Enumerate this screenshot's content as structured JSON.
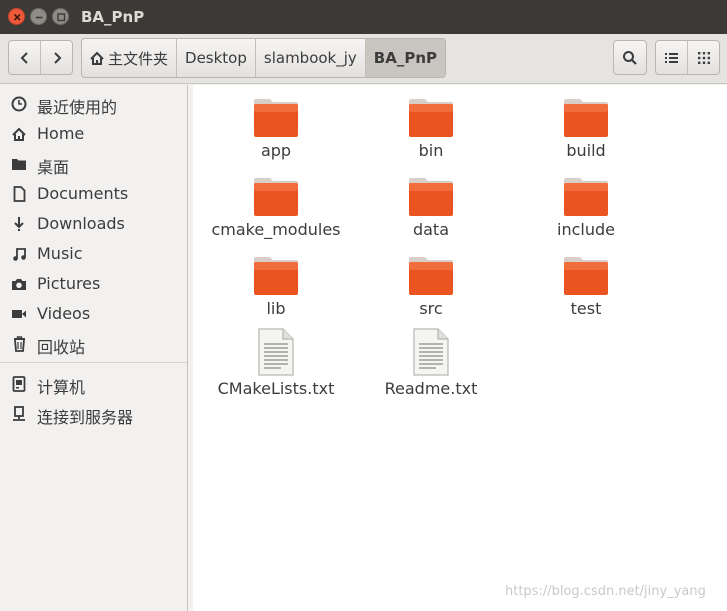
{
  "window": {
    "title": "BA_PnP"
  },
  "path": [
    "主文件夹",
    "Desktop",
    "slambook_jy",
    "BA_PnP"
  ],
  "sidebar": {
    "places": [
      {
        "label": "最近使用的",
        "icon": "recent-clock-icon"
      },
      {
        "label": "Home",
        "icon": "home-icon"
      },
      {
        "label": "桌面",
        "icon": "desktop-folder-icon"
      },
      {
        "label": "Documents",
        "icon": "document-icon"
      },
      {
        "label": "Downloads",
        "icon": "download-icon"
      },
      {
        "label": "Music",
        "icon": "music-icon"
      },
      {
        "label": "Pictures",
        "icon": "camera-icon"
      },
      {
        "label": "Videos",
        "icon": "video-icon"
      },
      {
        "label": "回收站",
        "icon": "trash-icon"
      }
    ],
    "devices": [
      {
        "label": "计算机",
        "icon": "computer-icon"
      },
      {
        "label": "连接到服务器",
        "icon": "network-server-icon"
      }
    ]
  },
  "files": [
    {
      "name": "app",
      "type": "folder"
    },
    {
      "name": "bin",
      "type": "folder"
    },
    {
      "name": "build",
      "type": "folder"
    },
    {
      "name": "cmake_modules",
      "type": "folder"
    },
    {
      "name": "data",
      "type": "folder"
    },
    {
      "name": "include",
      "type": "folder"
    },
    {
      "name": "lib",
      "type": "folder"
    },
    {
      "name": "src",
      "type": "folder"
    },
    {
      "name": "test",
      "type": "folder"
    },
    {
      "name": "CMakeLists.txt",
      "type": "text-file"
    },
    {
      "name": "Readme.txt",
      "type": "text-file"
    }
  ],
  "watermark": "https://blog.csdn.net/jiny_yang",
  "colors": {
    "folder_orange": "#e95420",
    "titlebar": "#3b3a36",
    "close_button": "#f0583a"
  }
}
